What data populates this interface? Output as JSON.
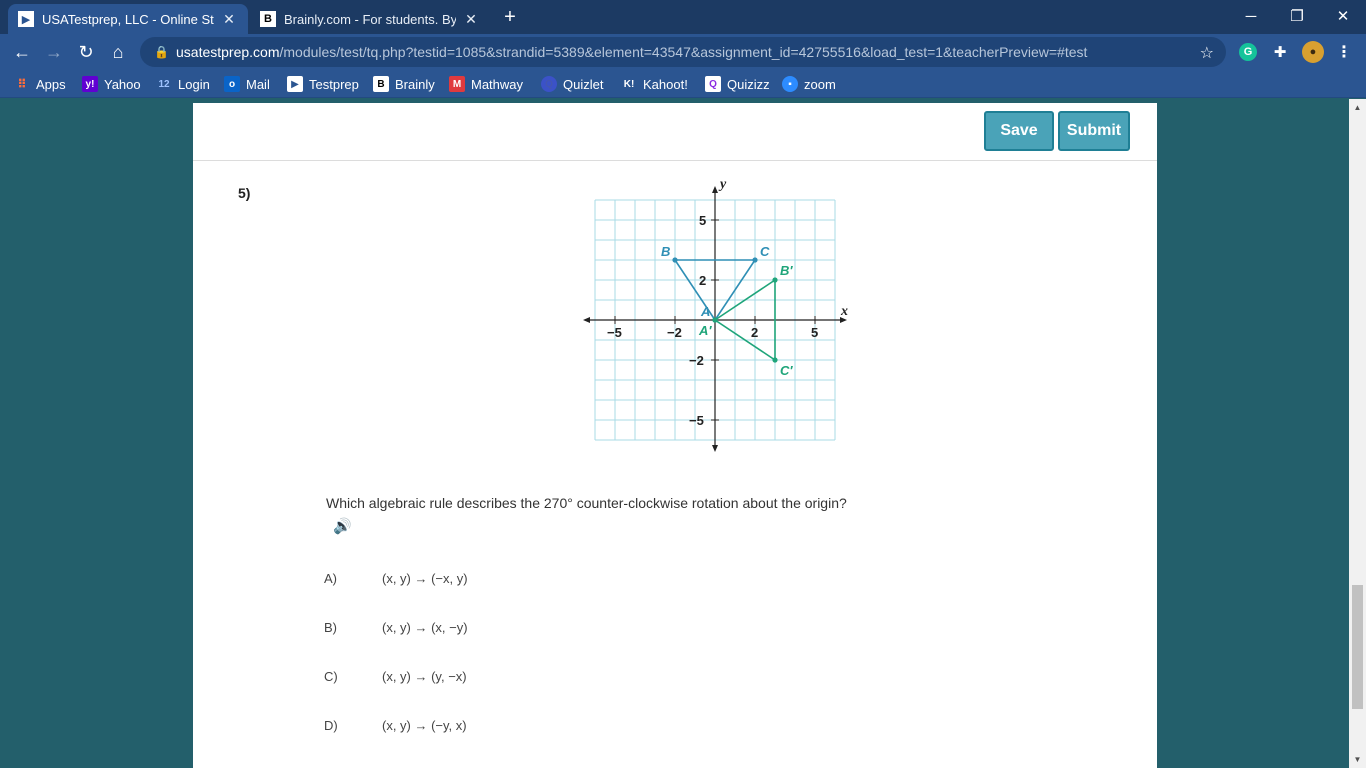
{
  "tabs": [
    {
      "title": "USATestprep, LLC - Online State-S",
      "active": true,
      "favicon": "usatestprep-logo-icon"
    },
    {
      "title": "Brainly.com - For students. By stu",
      "active": false,
      "favicon": "brainly-logo-icon"
    }
  ],
  "address_bar": {
    "host": "usatestprep.com",
    "path": "/modules/test/tq.php?testid=1085&strandid=5389&element=43547&assignment_id=42755516&load_test=1&teacherPreview=#test"
  },
  "bookmarks": [
    {
      "label": "Apps",
      "icon": "apps-grid-icon"
    },
    {
      "label": "Yahoo",
      "icon": "yahoo-icon"
    },
    {
      "label": "Login",
      "icon": "login-icon",
      "icon_text": "12"
    },
    {
      "label": "Mail",
      "icon": "outlook-mail-icon"
    },
    {
      "label": "Testprep",
      "icon": "testprep-icon"
    },
    {
      "label": "Brainly",
      "icon": "brainly-icon"
    },
    {
      "label": "Mathway",
      "icon": "mathway-icon"
    },
    {
      "label": "Quizlet",
      "icon": "quizlet-icon"
    },
    {
      "label": "Kahoot!",
      "icon": "kahoot-icon"
    },
    {
      "label": "Quizizz",
      "icon": "quizizz-icon"
    },
    {
      "label": "zoom",
      "icon": "zoom-icon"
    }
  ],
  "toolbar": {
    "save_label": "Save",
    "submit_label": "Submit"
  },
  "question": {
    "number": "5)",
    "text": "Which algebraic rule describes the 270° counter-clockwise rotation about the origin?",
    "choices": [
      {
        "letter": "A)",
        "text": "(x, y) → (−x, y)"
      },
      {
        "letter": "B)",
        "text": "(x, y) → (x, −y)"
      },
      {
        "letter": "C)",
        "text": "(x, y) → (y, −x)"
      },
      {
        "letter": "D)",
        "text": "(x, y) → (−y, x)"
      }
    ]
  },
  "graph": {
    "x_label": "x",
    "y_label": "y",
    "x_ticks": [
      {
        "v": -5,
        "t": "−5"
      },
      {
        "v": -2,
        "t": "−2"
      },
      {
        "v": 2,
        "t": "2"
      },
      {
        "v": 5,
        "t": "5"
      }
    ],
    "y_ticks": [
      {
        "v": 5,
        "t": "5"
      },
      {
        "v": 2,
        "t": "2"
      },
      {
        "v": -2,
        "t": "−2"
      },
      {
        "v": -5,
        "t": "−5"
      }
    ],
    "grid_range": [
      -6,
      6
    ],
    "original": {
      "color": "#2f8fb5",
      "points": [
        {
          "name": "A",
          "x": 0,
          "y": 0
        },
        {
          "name": "B",
          "x": -2,
          "y": 3
        },
        {
          "name": "C",
          "x": 2,
          "y": 3
        }
      ]
    },
    "image": {
      "color": "#1fa57a",
      "points": [
        {
          "name": "A′",
          "x": 0,
          "y": 0
        },
        {
          "name": "B′",
          "x": 3,
          "y": 2
        },
        {
          "name": "C′",
          "x": 3,
          "y": -2
        }
      ]
    }
  }
}
